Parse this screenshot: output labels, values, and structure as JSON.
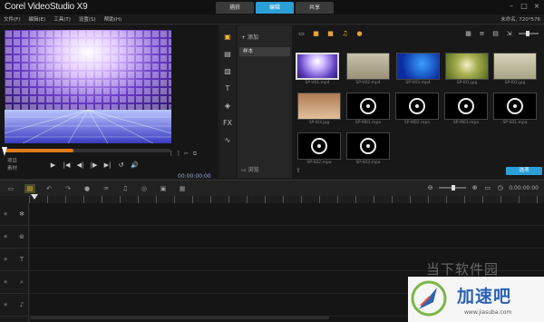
{
  "app": {
    "title": "Corel VideoStudio X9",
    "tabs": [
      {
        "label": "捕获",
        "active": false
      },
      {
        "label": "编辑",
        "active": true
      },
      {
        "label": "共享",
        "active": false
      }
    ],
    "window_controls": [
      "–",
      "□",
      "×"
    ],
    "project_info": "未命名, 720*576"
  },
  "menu": [
    "文件(F)",
    "编辑(E)",
    "工具(T)",
    "设置(S)",
    "帮助(H)"
  ],
  "player": {
    "mode_labels": [
      "项目",
      "素材"
    ],
    "transport": [
      "▶",
      "|◀",
      "◀|",
      "|▶",
      "▶|",
      "↺",
      "🔊"
    ],
    "trim": [
      "[",
      "]",
      "✂",
      "⧉"
    ],
    "timecode": "00:00:00:00",
    "scrub_position": 0.02
  },
  "library": {
    "rail_icons": [
      "media-icon",
      "instant-project-icon",
      "transition-icon",
      "title-icon",
      "graphic-icon",
      "filter-icon",
      "path-icon"
    ],
    "add_label": "添加",
    "folder": "样本",
    "browse_label": "浏览",
    "options_label": "选项",
    "thumbnails": [
      {
        "caption": "SP-V01.mp4",
        "kind": "video",
        "selected": true
      },
      {
        "caption": "SP-V02.mp4",
        "kind": "video2"
      },
      {
        "caption": "SP-V03.mp4",
        "kind": "video3"
      },
      {
        "caption": "SP-I01.jpg",
        "kind": "image1"
      },
      {
        "caption": "SP-I02.jpg",
        "kind": "image2"
      },
      {
        "caption": "SP-I03.jpg",
        "kind": "image3"
      },
      {
        "caption": "SP-M01.mpa",
        "kind": "audio"
      },
      {
        "caption": "SP-M02.mpa",
        "kind": "audio"
      },
      {
        "caption": "SP-M03.mpa",
        "kind": "audio"
      },
      {
        "caption": "SP-S01.mpa",
        "kind": "audio"
      },
      {
        "caption": "SP-S02.mpa",
        "kind": "audio"
      },
      {
        "caption": "SP-S03.mpa",
        "kind": "audio"
      }
    ]
  },
  "timeline": {
    "time": "0:00:00:00",
    "tracks": [
      "video",
      "overlay",
      "title",
      "voice",
      "music"
    ]
  },
  "watermark": {
    "overlay_text": "当下软件园",
    "brand": "加速吧",
    "url": "www.jiasuba.com"
  }
}
